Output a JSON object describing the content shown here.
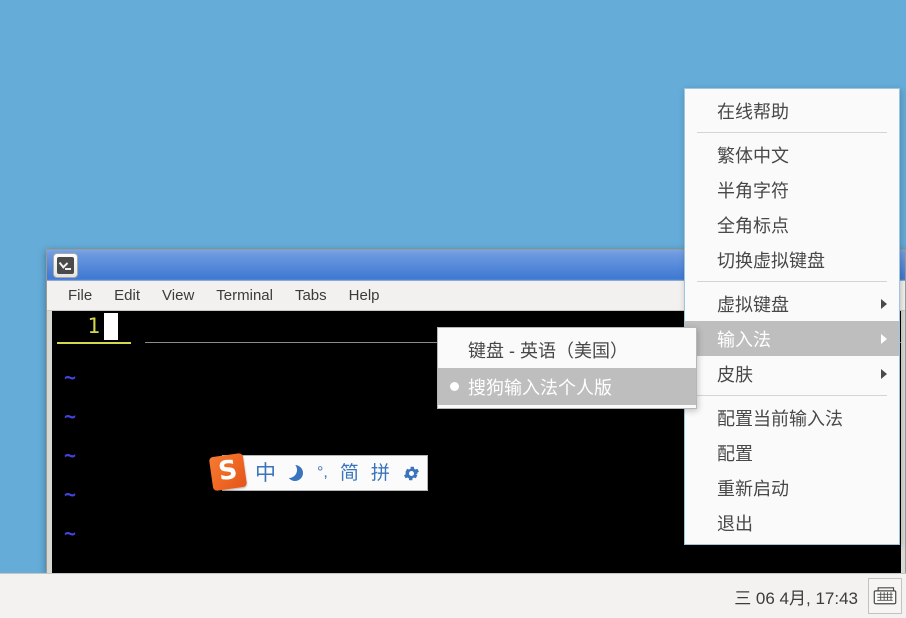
{
  "desktop": {
    "background_color": "#65acd8"
  },
  "terminal": {
    "title": "",
    "icon": "terminal-icon",
    "menubar": [
      {
        "label": "File"
      },
      {
        "label": "Edit"
      },
      {
        "label": "View"
      },
      {
        "label": "Terminal"
      },
      {
        "label": "Tabs"
      },
      {
        "label": "Help"
      }
    ],
    "editor": {
      "line_number": "1",
      "empty_line_marker": "~",
      "empty_line_count": 5,
      "linenum_color": "#d7d74f",
      "tilde_color": "#4343e0",
      "cursor_color": "#ffffff",
      "background_color": "#000000"
    }
  },
  "sogou_toolbar": {
    "logo_text": "S",
    "logo_color": "#ef6622",
    "accent_color": "#3a74bd",
    "buttons": [
      {
        "name": "chinese-mode",
        "label": "中"
      },
      {
        "name": "moon-icon",
        "label": ""
      },
      {
        "name": "punctuation-mode",
        "label": "°,"
      },
      {
        "name": "simplified-mode",
        "label": "简"
      },
      {
        "name": "pinyin-mode",
        "label": "拼"
      },
      {
        "name": "gear-icon",
        "label": ""
      }
    ]
  },
  "fcitx_menu": {
    "items": [
      {
        "label": "在线帮助",
        "type": "item",
        "highlighted": false,
        "submenu": false
      },
      {
        "label": "",
        "type": "separator"
      },
      {
        "label": "繁体中文",
        "type": "item",
        "highlighted": false,
        "submenu": false
      },
      {
        "label": "半角字符",
        "type": "item",
        "highlighted": false,
        "submenu": false
      },
      {
        "label": "全角标点",
        "type": "item",
        "highlighted": false,
        "submenu": false
      },
      {
        "label": "切换虚拟键盘",
        "type": "item",
        "highlighted": false,
        "submenu": false
      },
      {
        "label": "",
        "type": "separator"
      },
      {
        "label": "虚拟键盘",
        "type": "item",
        "highlighted": false,
        "submenu": true
      },
      {
        "label": "输入法",
        "type": "item",
        "highlighted": true,
        "submenu": true
      },
      {
        "label": "皮肤",
        "type": "item",
        "highlighted": false,
        "submenu": true
      },
      {
        "label": "",
        "type": "separator"
      },
      {
        "label": "配置当前输入法",
        "type": "item",
        "highlighted": false,
        "submenu": false
      },
      {
        "label": "配置",
        "type": "item",
        "highlighted": false,
        "submenu": false
      },
      {
        "label": "重新启动",
        "type": "item",
        "highlighted": false,
        "submenu": false
      },
      {
        "label": "退出",
        "type": "item",
        "highlighted": false,
        "submenu": false
      }
    ],
    "highlight_color": "#bebebe",
    "border_color": "#9fc4dd"
  },
  "fcitx_submenu": {
    "items": [
      {
        "label": "键盘 - 英语（美国）",
        "selected": false,
        "highlighted": false
      },
      {
        "label": "搜狗输入法个人版",
        "selected": true,
        "highlighted": true
      }
    ]
  },
  "taskbar": {
    "clock": "三 06 4月, 17:43",
    "tray_icon": "keyboard-icon"
  }
}
